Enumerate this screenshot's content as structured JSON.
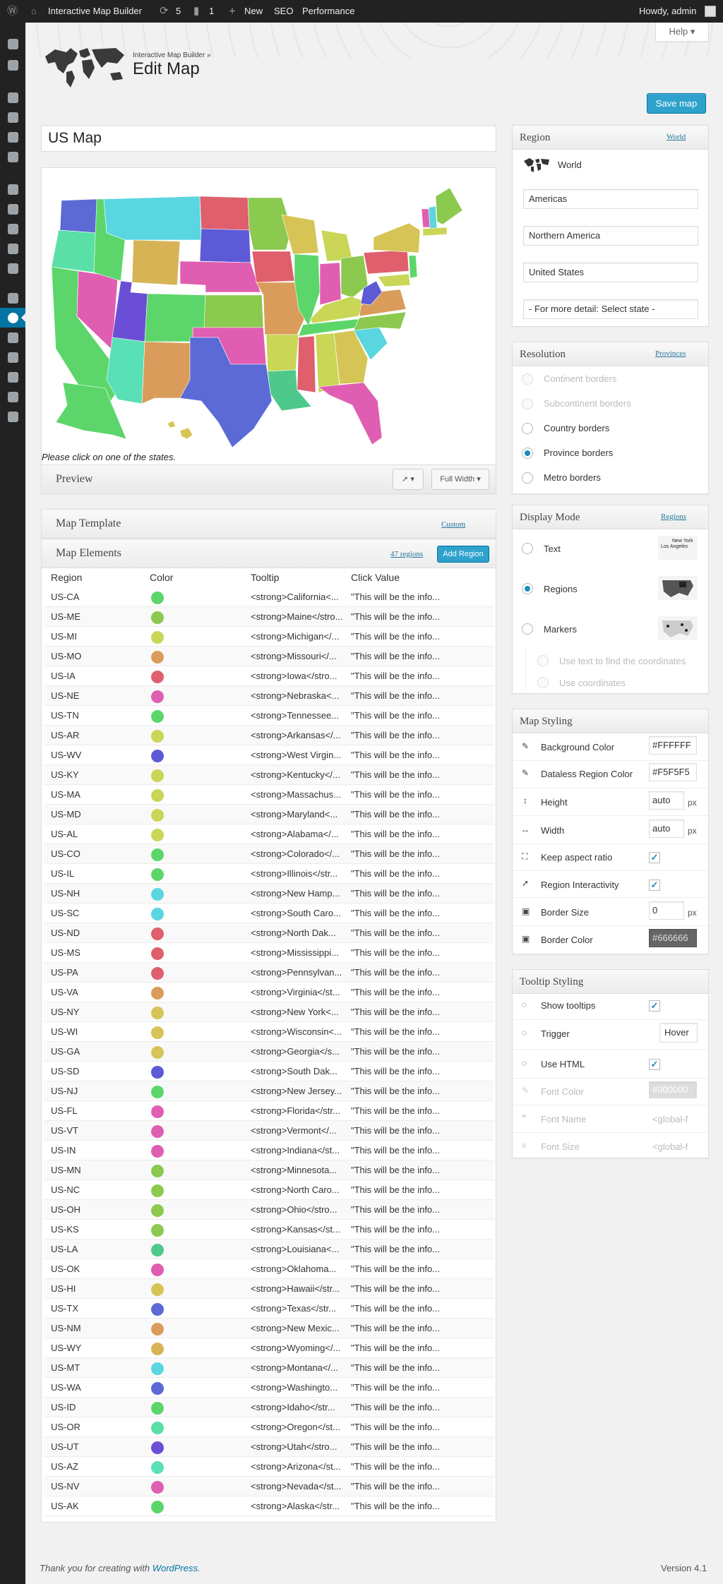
{
  "admin_bar": {
    "site_name": "Interactive Map Builder",
    "updates_count": "5",
    "comments_count": "1",
    "new_label": "New",
    "seo_label": "SEO",
    "performance_label": "Performance",
    "greeting": "Howdy, admin"
  },
  "header": {
    "help_label": "Help",
    "breadcrumb": "Interactive Map Builder »",
    "title": "Edit Map",
    "save_label": "Save map"
  },
  "map": {
    "name": "US Map",
    "hint": "Please click on one of the states.",
    "preview_label": "Preview",
    "width_option": "Full Width"
  },
  "template": {
    "label": "Map Template",
    "link": "Custom"
  },
  "elements": {
    "label": "Map Elements",
    "count_link": "47 regions",
    "add_label": "Add Region",
    "columns": [
      "Region",
      "Color",
      "Tooltip",
      "Click Value"
    ],
    "rows": [
      {
        "region": "US-CA",
        "color": "#5cd66a",
        "tooltip": "<strong>California<...",
        "click": "\"This will be the info..."
      },
      {
        "region": "US-ME",
        "color": "#8bc94f",
        "tooltip": "<strong>Maine</stro...",
        "click": "\"This will be the info..."
      },
      {
        "region": "US-MI",
        "color": "#c9d656",
        "tooltip": "<strong>Michigan</...",
        "click": "\"This will be the info..."
      },
      {
        "region": "US-MO",
        "color": "#d99c5a",
        "tooltip": "<strong>Missouri</...",
        "click": "\"This will be the info..."
      },
      {
        "region": "US-IA",
        "color": "#df5f6c",
        "tooltip": "<strong>Iowa</stro...",
        "click": "\"This will be the info..."
      },
      {
        "region": "US-NE",
        "color": "#e05eb1",
        "tooltip": "<strong>Nebraska<...",
        "click": "\"This will be the info..."
      },
      {
        "region": "US-TN",
        "color": "#5cd66a",
        "tooltip": "<strong>Tennessee...",
        "click": "\"This will be the info..."
      },
      {
        "region": "US-AR",
        "color": "#c9d656",
        "tooltip": "<strong>Arkansas</...",
        "click": "\"This will be the info..."
      },
      {
        "region": "US-WV",
        "color": "#5c5ad6",
        "tooltip": "<strong>West Virgin...",
        "click": "\"This will be the info..."
      },
      {
        "region": "US-KY",
        "color": "#c9d656",
        "tooltip": "<strong>Kentucky</...",
        "click": "\"This will be the info..."
      },
      {
        "region": "US-MA",
        "color": "#c9d656",
        "tooltip": "<strong>Massachus...",
        "click": "\"This will be the info..."
      },
      {
        "region": "US-MD",
        "color": "#c9d656",
        "tooltip": "<strong>Maryland<...",
        "click": "\"This will be the info..."
      },
      {
        "region": "US-AL",
        "color": "#c9d656",
        "tooltip": "<strong>Alabama</...",
        "click": "\"This will be the info..."
      },
      {
        "region": "US-CO",
        "color": "#5cd66a",
        "tooltip": "<strong>Colorado</...",
        "click": "\"This will be the info..."
      },
      {
        "region": "US-IL",
        "color": "#5cd66a",
        "tooltip": "<strong>Illinois</str...",
        "click": "\"This will be the info..."
      },
      {
        "region": "US-NH",
        "color": "#5ad6e0",
        "tooltip": "<strong>New Hamp...",
        "click": "\"This will be the info..."
      },
      {
        "region": "US-SC",
        "color": "#5ad6e0",
        "tooltip": "<strong>South Caro...",
        "click": "\"This will be the info..."
      },
      {
        "region": "US-ND",
        "color": "#df5f6c",
        "tooltip": "<strong>North Dak...",
        "click": "\"This will be the info..."
      },
      {
        "region": "US-MS",
        "color": "#df5f6c",
        "tooltip": "<strong>Mississippi...",
        "click": "\"This will be the info..."
      },
      {
        "region": "US-PA",
        "color": "#df5f6c",
        "tooltip": "<strong>Pennsylvan...",
        "click": "\"This will be the info..."
      },
      {
        "region": "US-VA",
        "color": "#d99c5a",
        "tooltip": "<strong>Virginia</st...",
        "click": "\"This will be the info..."
      },
      {
        "region": "US-NY",
        "color": "#d6c456",
        "tooltip": "<strong>New York<...",
        "click": "\"This will be the info..."
      },
      {
        "region": "US-WI",
        "color": "#d6c456",
        "tooltip": "<strong>Wisconsin<...",
        "click": "\"This will be the info..."
      },
      {
        "region": "US-GA",
        "color": "#d6c456",
        "tooltip": "<strong>Georgia</s...",
        "click": "\"This will be the info..."
      },
      {
        "region": "US-SD",
        "color": "#5c5ad6",
        "tooltip": "<strong>South Dak...",
        "click": "\"This will be the info..."
      },
      {
        "region": "US-NJ",
        "color": "#5cd66a",
        "tooltip": "<strong>New Jersey...",
        "click": "\"This will be the info..."
      },
      {
        "region": "US-FL",
        "color": "#e05eb1",
        "tooltip": "<strong>Florida</str...",
        "click": "\"This will be the info..."
      },
      {
        "region": "US-VT",
        "color": "#e05eb1",
        "tooltip": "<strong>Vermont</...",
        "click": "\"This will be the info..."
      },
      {
        "region": "US-IN",
        "color": "#e05eb1",
        "tooltip": "<strong>Indiana</st...",
        "click": "\"This will be the info..."
      },
      {
        "region": "US-MN",
        "color": "#8bc94f",
        "tooltip": "<strong>Minnesota...",
        "click": "\"This will be the info..."
      },
      {
        "region": "US-NC",
        "color": "#8bc94f",
        "tooltip": "<strong>North Caro...",
        "click": "\"This will be the info..."
      },
      {
        "region": "US-OH",
        "color": "#8bc94f",
        "tooltip": "<strong>Ohio</stro...",
        "click": "\"This will be the info..."
      },
      {
        "region": "US-KS",
        "color": "#8bc94f",
        "tooltip": "<strong>Kansas</st...",
        "click": "\"This will be the info..."
      },
      {
        "region": "US-LA",
        "color": "#4fc98b",
        "tooltip": "<strong>Louisiana<...",
        "click": "\"This will be the info..."
      },
      {
        "region": "US-OK",
        "color": "#e05eb1",
        "tooltip": "<strong>Oklahoma...",
        "click": "\"This will be the info..."
      },
      {
        "region": "US-HI",
        "color": "#d6c456",
        "tooltip": "<strong>Hawaii</str...",
        "click": "\"This will be the info..."
      },
      {
        "region": "US-TX",
        "color": "#5c6ad6",
        "tooltip": "<strong>Texas</str...",
        "click": "\"This will be the info..."
      },
      {
        "region": "US-NM",
        "color": "#d99c5a",
        "tooltip": "<strong>New Mexic...",
        "click": "\"This will be the info..."
      },
      {
        "region": "US-WY",
        "color": "#d6b456",
        "tooltip": "<strong>Wyoming</...",
        "click": "\"This will be the info..."
      },
      {
        "region": "US-MT",
        "color": "#5ad6e0",
        "tooltip": "<strong>Montana</...",
        "click": "\"This will be the info..."
      },
      {
        "region": "US-WA",
        "color": "#5c6ad6",
        "tooltip": "<strong>Washingto...",
        "click": "\"This will be the info..."
      },
      {
        "region": "US-ID",
        "color": "#5cd66a",
        "tooltip": "<strong>Idaho</str...",
        "click": "\"This will be the info..."
      },
      {
        "region": "US-OR",
        "color": "#5ae0a6",
        "tooltip": "<strong>Oregon</st...",
        "click": "\"This will be the info..."
      },
      {
        "region": "US-UT",
        "color": "#6a4fd6",
        "tooltip": "<strong>Utah</stro...",
        "click": "\"This will be the info..."
      },
      {
        "region": "US-AZ",
        "color": "#5ae0b6",
        "tooltip": "<strong>Arizona</st...",
        "click": "\"This will be the info..."
      },
      {
        "region": "US-NV",
        "color": "#e05eb1",
        "tooltip": "<strong>Nevada</st...",
        "click": "\"This will be the info..."
      },
      {
        "region": "US-AK",
        "color": "#5cd66a",
        "tooltip": "<strong>Alaska</str...",
        "click": "\"This will be the info..."
      }
    ]
  },
  "region_panel": {
    "title": "Region",
    "link": "World",
    "world_label": "World",
    "level1": "Americas",
    "level2": "Northern America",
    "level3": "United States",
    "level4": "- For more detail: Select state -"
  },
  "resolution_panel": {
    "title": "Resolution",
    "link": "Provinces",
    "options": [
      "Continent borders",
      "Subcontinent borders",
      "Country borders",
      "Province borders",
      "Metro borders"
    ],
    "selected": "Province borders"
  },
  "display_panel": {
    "title": "Display Mode",
    "link": "Regions",
    "options": [
      "Text",
      "Regions",
      "Markers"
    ],
    "selected": "Regions",
    "sub_options": [
      "Use text to find the coordinates",
      "Use coordinates"
    ],
    "thumb_labels": [
      "New York",
      "Los Angeles"
    ]
  },
  "styling_panel": {
    "title": "Map Styling",
    "bg_label": "Background Color",
    "bg_value": "#FFFFFF",
    "dataless_label": "Dataless Region Color",
    "dataless_value": "#F5F5F5",
    "height_label": "Height",
    "height_value": "auto",
    "width_label": "Width",
    "width_value": "auto",
    "unit": "px",
    "aspect_label": "Keep aspect ratio",
    "interactivity_label": "Region Interactivity",
    "border_size_label": "Border Size",
    "border_size_value": "0",
    "border_color_label": "Border Color",
    "border_color_value": "#666666"
  },
  "tooltip_panel": {
    "title": "Tooltip Styling",
    "show_label": "Show tooltips",
    "trigger_label": "Trigger",
    "trigger_value": "Hover",
    "html_label": "Use HTML",
    "font_color_label": "Font Color",
    "font_color_value": "#000000",
    "font_name_label": "Font Name",
    "font_name_value": "<global-f",
    "font_size_label": "Font Size",
    "font_size_value": "<global-f"
  },
  "footer": {
    "thanks_prefix": "Thank you for creating with ",
    "wp_link": "WordPress",
    "thanks_suffix": ".",
    "version": "Version 4.1"
  }
}
